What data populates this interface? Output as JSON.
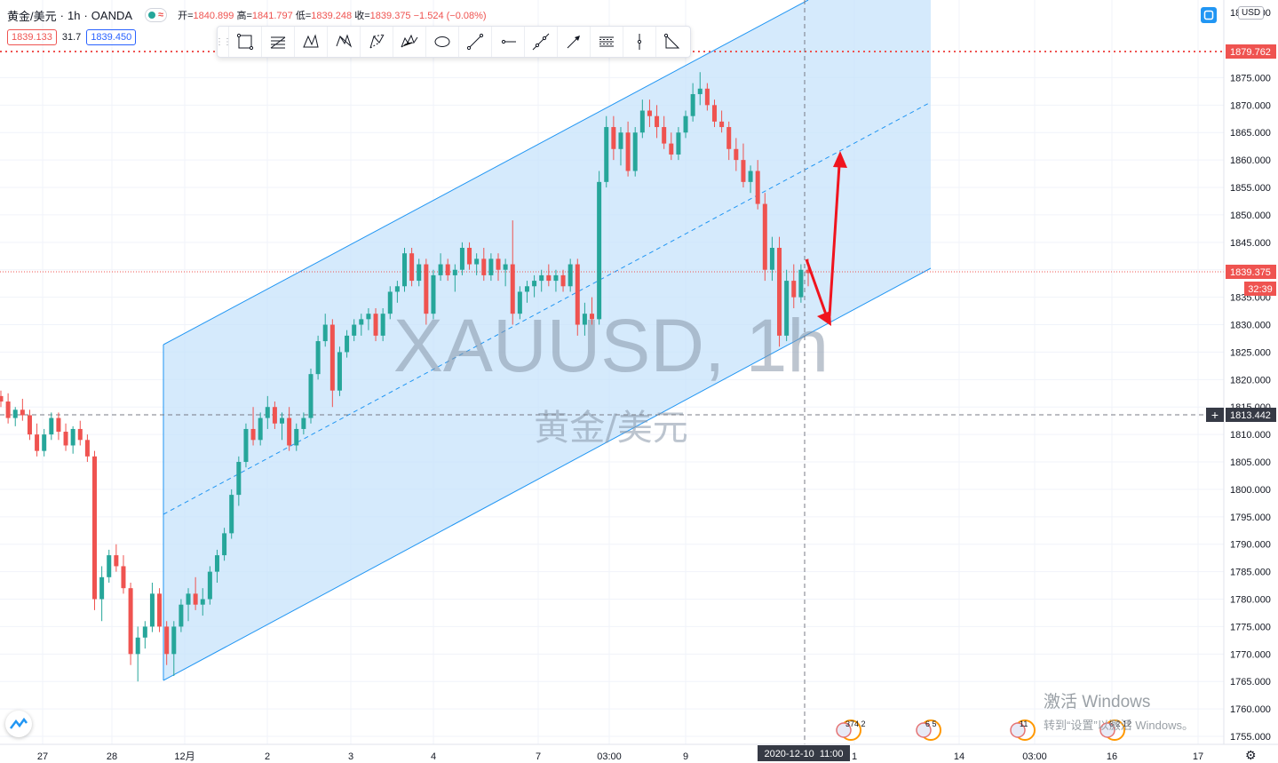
{
  "header": {
    "symbol_name": "黄金/美元",
    "interval": "1h",
    "broker": "OANDA",
    "ohlc": {
      "open_label": "开",
      "open": "1840.899",
      "high_label": "高",
      "high": "1841.797",
      "low_label": "低",
      "low": "1839.248",
      "close_label": "收",
      "close": "1839.375",
      "change": "−1.524 (−0.08%)"
    }
  },
  "quote": {
    "sell": "1839.133",
    "spread": "31.7",
    "buy": "1839.450"
  },
  "currency_button": "USD",
  "watermark": {
    "symbol": "XAUUSD, 1h",
    "name": "黄金/美元"
  },
  "toolbar": {
    "tools": [
      {
        "name": "rectangle-tool-icon"
      },
      {
        "name": "fib-retracement-tool-icon"
      },
      {
        "name": "xabcd-pattern-tool-icon"
      },
      {
        "name": "cypher-pattern-tool-icon"
      },
      {
        "name": "abcd-pattern-tool-icon"
      },
      {
        "name": "elliott-wave-tool-icon"
      },
      {
        "name": "ellipse-tool-icon"
      },
      {
        "name": "trend-line-tool-icon"
      },
      {
        "name": "horizontal-ray-tool-icon"
      },
      {
        "name": "extended-line-tool-icon"
      },
      {
        "name": "arrow-tool-icon"
      },
      {
        "name": "parallel-lines-tool-icon"
      },
      {
        "name": "vertical-line-tool-icon"
      },
      {
        "name": "triangle-pattern-tool-icon"
      }
    ]
  },
  "price_axis": {
    "ticks": [
      "1885.000",
      "1875.000",
      "1870.000",
      "1865.000",
      "1860.000",
      "1855.000",
      "1850.000",
      "1845.000",
      "1840.000",
      "1835.000",
      "1830.000",
      "1825.000",
      "1820.000",
      "1815.000",
      "1810.000",
      "1805.000",
      "1800.000",
      "1795.000",
      "1790.000",
      "1785.000",
      "1780.000",
      "1775.000",
      "1770.000",
      "1765.000",
      "1760.000",
      "1755.000"
    ],
    "labels": {
      "alert_level": "1879.762",
      "last_price": "1839.375",
      "countdown": "32:39",
      "crosshair_price": "1813.442"
    }
  },
  "time_axis": {
    "ticks": [
      "27",
      "28",
      "12月",
      "2",
      "3",
      "4",
      "7",
      "03:00",
      "9",
      "1",
      "14",
      "03:00",
      "16",
      "17"
    ],
    "crosshair_label": "2020-12-10  11:00"
  },
  "events": [
    "374 2",
    "6 5",
    "11",
    "6 2 12"
  ],
  "colors": {
    "up": "#26a69a",
    "down": "#ef5350",
    "channel": "#2196f3",
    "arrow": "#f0141e"
  },
  "chart_data": {
    "type": "candlestick",
    "symbol": "XAUUSD",
    "interval": "1h",
    "ylim": [
      1752.5,
      1887.5
    ],
    "last_price": 1839.375,
    "channel": {
      "upper": [
        [
          1826.5,
          1887.9
        ],
        [
          1887.9,
          1887.9
        ]
      ],
      "note": ""
    },
    "candles": [
      [
        1817.0,
        1818.0,
        1815.0,
        1816.0
      ],
      [
        1816.0,
        1817.5,
        1812.0,
        1813.0
      ],
      [
        1813.0,
        1815.0,
        1811.5,
        1814.5
      ],
      [
        1814.5,
        1816.5,
        1812.5,
        1813.5
      ],
      [
        1813.5,
        1814.5,
        1809.0,
        1810.0
      ],
      [
        1810.0,
        1812.0,
        1806.0,
        1807.0
      ],
      [
        1807.0,
        1811.0,
        1806.0,
        1810.0
      ],
      [
        1810.0,
        1814.0,
        1809.0,
        1813.0
      ],
      [
        1813.0,
        1814.0,
        1809.0,
        1810.5
      ],
      [
        1810.5,
        1812.0,
        1807.0,
        1808.0
      ],
      [
        1808.0,
        1811.5,
        1806.5,
        1811.0
      ],
      [
        1811.0,
        1812.5,
        1808.0,
        1809.0
      ],
      [
        1809.0,
        1810.0,
        1805.0,
        1806.0
      ],
      [
        1806.0,
        1807.0,
        1778.0,
        1780.0
      ],
      [
        1780.0,
        1786.0,
        1776.0,
        1784.0
      ],
      [
        1784.0,
        1789.0,
        1783.0,
        1788.0
      ],
      [
        1788.0,
        1790.0,
        1785.0,
        1786.0
      ],
      [
        1786.0,
        1788.0,
        1781.0,
        1782.0
      ],
      [
        1782.0,
        1783.0,
        1768.0,
        1770.0
      ],
      [
        1770.0,
        1775.0,
        1765.0,
        1773.0
      ],
      [
        1773.0,
        1776.0,
        1771.0,
        1775.0
      ],
      [
        1775.0,
        1783.0,
        1774.0,
        1781.0
      ],
      [
        1781.0,
        1782.0,
        1774.0,
        1775.0
      ],
      [
        1775.0,
        1776.0,
        1768.0,
        1770.0
      ],
      [
        1770.0,
        1776.0,
        1766.0,
        1775.0
      ],
      [
        1775.0,
        1780.0,
        1774.0,
        1779.0
      ],
      [
        1779.0,
        1782.0,
        1776.0,
        1781.0
      ],
      [
        1781.0,
        1784.0,
        1778.0,
        1779.0
      ],
      [
        1779.0,
        1782.0,
        1777.0,
        1780.0
      ],
      [
        1780.0,
        1786.0,
        1779.0,
        1785.0
      ],
      [
        1785.0,
        1789.0,
        1783.0,
        1788.0
      ],
      [
        1788.0,
        1793.0,
        1787.0,
        1792.0
      ],
      [
        1792.0,
        1800.0,
        1791.0,
        1799.0
      ],
      [
        1799.0,
        1806.0,
        1797.0,
        1805.0
      ],
      [
        1805.0,
        1812.0,
        1804.0,
        1811.0
      ],
      [
        1811.0,
        1815.0,
        1808.0,
        1809.0
      ],
      [
        1809.0,
        1814.0,
        1808.0,
        1813.0
      ],
      [
        1813.0,
        1817.0,
        1811.0,
        1815.0
      ],
      [
        1815.0,
        1816.0,
        1811.0,
        1812.0
      ],
      [
        1812.0,
        1814.0,
        1809.0,
        1813.0
      ],
      [
        1813.0,
        1815.0,
        1807.0,
        1808.0
      ],
      [
        1808.0,
        1812.0,
        1807.0,
        1811.0
      ],
      [
        1811.0,
        1814.0,
        1810.0,
        1813.0
      ],
      [
        1813.0,
        1822.0,
        1812.0,
        1821.0
      ],
      [
        1821.0,
        1828.0,
        1820.0,
        1827.0
      ],
      [
        1827.0,
        1832.0,
        1826.0,
        1830.0
      ],
      [
        1830.0,
        1831.0,
        1815.0,
        1818.0
      ],
      [
        1818.0,
        1826.0,
        1817.0,
        1825.0
      ],
      [
        1825.0,
        1829.0,
        1824.0,
        1828.0
      ],
      [
        1828.0,
        1831.0,
        1827.0,
        1830.0
      ],
      [
        1830.0,
        1832.0,
        1828.0,
        1831.0
      ],
      [
        1831.0,
        1833.0,
        1829.0,
        1832.0
      ],
      [
        1832.0,
        1833.0,
        1827.0,
        1828.0
      ],
      [
        1828.0,
        1833.0,
        1827.0,
        1832.0
      ],
      [
        1832.0,
        1837.0,
        1831.0,
        1836.0
      ],
      [
        1836.0,
        1838.0,
        1834.0,
        1837.0
      ],
      [
        1837.0,
        1844.0,
        1836.0,
        1843.0
      ],
      [
        1843.0,
        1844.0,
        1837.0,
        1838.0
      ],
      [
        1838.0,
        1842.0,
        1837.0,
        1841.0
      ],
      [
        1841.0,
        1842.0,
        1830.0,
        1832.0
      ],
      [
        1832.0,
        1840.0,
        1831.0,
        1839.0
      ],
      [
        1839.0,
        1843.0,
        1838.0,
        1841.0
      ],
      [
        1841.0,
        1842.0,
        1838.0,
        1839.0
      ],
      [
        1839.0,
        1841.0,
        1836.0,
        1840.0
      ],
      [
        1840.0,
        1845.0,
        1839.0,
        1844.0
      ],
      [
        1844.0,
        1845.0,
        1840.0,
        1841.0
      ],
      [
        1841.0,
        1843.0,
        1839.0,
        1842.0
      ],
      [
        1842.0,
        1844.0,
        1838.0,
        1839.0
      ],
      [
        1839.0,
        1843.0,
        1838.0,
        1842.0
      ],
      [
        1842.0,
        1843.0,
        1838.0,
        1840.0
      ],
      [
        1840.0,
        1842.0,
        1837.0,
        1841.0
      ],
      [
        1841.0,
        1849.0,
        1830.0,
        1832.0
      ],
      [
        1832.0,
        1837.0,
        1831.0,
        1836.0
      ],
      [
        1836.0,
        1838.0,
        1834.0,
        1837.0
      ],
      [
        1837.0,
        1839.0,
        1835.0,
        1838.0
      ],
      [
        1838.0,
        1840.0,
        1836.0,
        1839.0
      ],
      [
        1839.0,
        1841.0,
        1837.0,
        1838.0
      ],
      [
        1838.0,
        1840.0,
        1836.0,
        1839.0
      ],
      [
        1839.0,
        1840.0,
        1836.0,
        1837.0
      ],
      [
        1837.0,
        1842.0,
        1836.0,
        1841.0
      ],
      [
        1841.0,
        1842.0,
        1828.0,
        1830.0
      ],
      [
        1830.0,
        1834.0,
        1828.0,
        1832.0
      ],
      [
        1832.0,
        1835.0,
        1830.0,
        1831.0
      ],
      [
        1831.0,
        1858.0,
        1830.0,
        1856.0
      ],
      [
        1856.0,
        1868.0,
        1855.0,
        1866.0
      ],
      [
        1866.0,
        1868.0,
        1860.0,
        1862.0
      ],
      [
        1862.0,
        1866.0,
        1859.0,
        1865.0
      ],
      [
        1865.0,
        1867.0,
        1857.0,
        1858.0
      ],
      [
        1858.0,
        1866.0,
        1857.0,
        1865.0
      ],
      [
        1865.0,
        1871.0,
        1864.0,
        1869.0
      ],
      [
        1869.0,
        1871.0,
        1866.0,
        1868.0
      ],
      [
        1868.0,
        1870.0,
        1864.0,
        1866.0
      ],
      [
        1866.0,
        1868.0,
        1862.0,
        1863.0
      ],
      [
        1863.0,
        1865.0,
        1860.0,
        1861.0
      ],
      [
        1861.0,
        1866.0,
        1860.0,
        1865.0
      ],
      [
        1865.0,
        1869.0,
        1864.0,
        1868.0
      ],
      [
        1868.0,
        1874.0,
        1867.0,
        1872.0
      ],
      [
        1872.0,
        1876.0,
        1870.0,
        1873.0
      ],
      [
        1873.0,
        1874.0,
        1869.0,
        1870.0
      ],
      [
        1870.0,
        1871.0,
        1866.0,
        1867.0
      ],
      [
        1867.0,
        1869.0,
        1865.0,
        1866.0
      ],
      [
        1866.0,
        1867.0,
        1860.0,
        1862.0
      ],
      [
        1862.0,
        1864.0,
        1858.0,
        1860.0
      ],
      [
        1860.0,
        1863.0,
        1855.0,
        1856.0
      ],
      [
        1856.0,
        1859.0,
        1854.0,
        1858.0
      ],
      [
        1858.0,
        1860.0,
        1851.0,
        1852.0
      ],
      [
        1852.0,
        1854.0,
        1838.0,
        1840.0
      ],
      [
        1840.0,
        1846.0,
        1838.0,
        1844.0
      ],
      [
        1844.0,
        1846.0,
        1826.0,
        1828.0
      ],
      [
        1828.0,
        1840.0,
        1827.0,
        1838.0
      ],
      [
        1838.0,
        1841.0,
        1833.0,
        1835.0
      ],
      [
        1835.0,
        1841.0,
        1834.0,
        1840.0
      ],
      [
        1840.0,
        1842.0,
        1837.0,
        1839.4
      ]
    ]
  }
}
